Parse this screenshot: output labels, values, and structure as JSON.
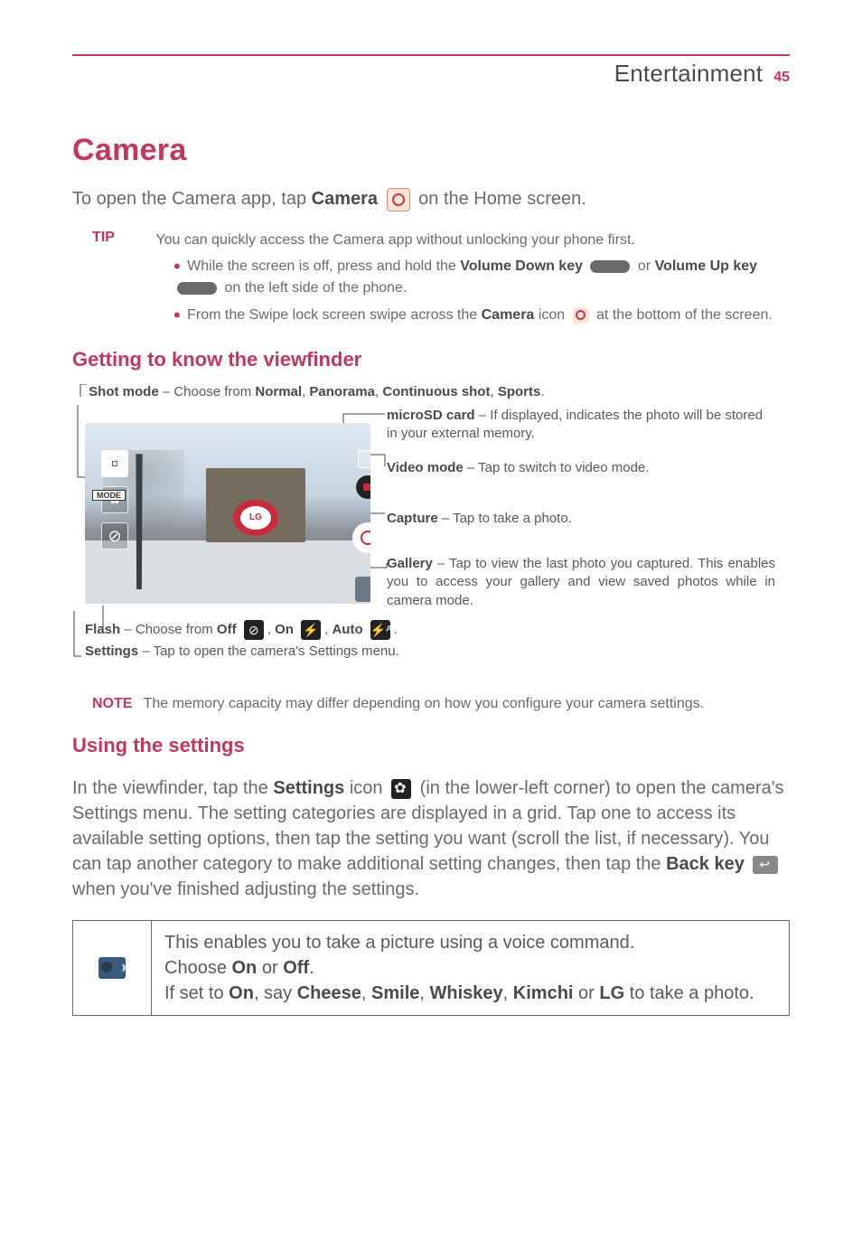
{
  "header": {
    "section": "Entertainment",
    "page": "45"
  },
  "title": "Camera",
  "intro": {
    "pre": "To open the Camera app, tap ",
    "boldCamera": "Camera",
    "post": " on the Home screen."
  },
  "tip": {
    "label": "TIP",
    "intro": "You can quickly access the Camera app without unlocking your phone first.",
    "bullet1a": "While the screen is off, press and hold the ",
    "volDown": "Volume Down key",
    "or": " or ",
    "volUp": "Volume Up key",
    "bullet1b": " on the left side of the phone.",
    "bullet2a": "From the Swipe lock screen swipe across the ",
    "cameraBold": "Camera",
    "iconWord": " icon ",
    "bullet2b": " at the bottom of the screen."
  },
  "viewfinder": {
    "heading": "Getting to know the viewfinder",
    "billboard": "LG",
    "modeBadge": "MODE",
    "shotmode": {
      "label": "Shot mode",
      "desc": " – Choose from ",
      "opt1": "Normal",
      "opt2": "Panorama",
      "opt3": "Continuous shot",
      "opt4": "Sports"
    },
    "microsd": {
      "label": "microSD card",
      "desc": " – If displayed, indicates the photo will be stored in your external memory."
    },
    "videomode": {
      "label": "Video mode",
      "desc": " – Tap to switch to video mode."
    },
    "capture": {
      "label": "Capture",
      "desc": " – Tap to take a photo."
    },
    "gallery": {
      "label": "Gallery",
      "desc": " – Tap to view the last photo you captured. This enables you to access your gallery and view saved photos while in camera mode."
    },
    "flash": {
      "label": "Flash",
      "desc": " – Choose from ",
      "off": "Off",
      "on": "On",
      "auto": "Auto"
    },
    "settings": {
      "label": "Settings",
      "desc": " – Tap to open the camera's Settings menu."
    }
  },
  "note": {
    "label": "NOTE",
    "text": "The memory capacity may differ depending on how you configure your camera settings."
  },
  "usingSettings": {
    "heading": "Using the settings",
    "para1a": "In the viewfinder, tap the ",
    "settingsBold": "Settings",
    "iconWord": " icon ",
    "para1b": " (in the lower-left corner) to open the camera's Settings menu. The setting categories are displayed in a grid. Tap one to access its available setting options, then tap the setting you want (scroll the list, if necessary). You can tap another category to make additional setting changes, then tap the ",
    "backKey": "Back key",
    "para1c": " when you've finished adjusting the settings."
  },
  "table": {
    "cheeseRow": {
      "line1": "This enables you to take a picture using a voice command.",
      "line2a": "Choose ",
      "on": "On",
      "or": " or ",
      "off": "Off",
      "line2b": ".",
      "line3a": "If set to ",
      "on2": "On",
      "say": ", say ",
      "w1": "Cheese",
      "w2": "Smile",
      "w3": "Whiskey",
      "w4": "Kimchi",
      "or2": " or ",
      "w5": "LG",
      "line3b": " to take a photo."
    }
  }
}
